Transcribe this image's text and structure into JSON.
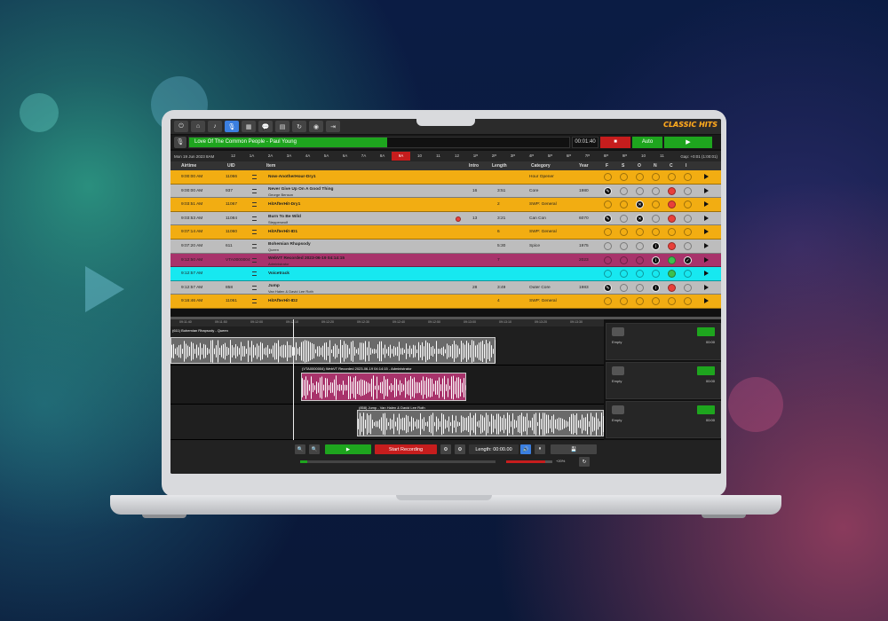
{
  "toolbar": {
    "icons": [
      "power-icon",
      "home-icon",
      "music-icon",
      "mic-icon",
      "grid-icon",
      "chat-icon",
      "document-icon",
      "refresh-icon",
      "spotify-icon",
      "exit-icon"
    ],
    "logo_text": "CLASSIC HITS",
    "active_index": 3
  },
  "now_playing": {
    "title": "Love Of The Common People - Paul Young",
    "progress": 0.52,
    "remaining": "00:01:40",
    "stop_label": "■",
    "auto_label": "Auto",
    "play_label": "▶"
  },
  "hours_bar": {
    "date": "Mon 19 Jun 2023 8AM",
    "hours": [
      "12",
      "1A",
      "2A",
      "3A",
      "4A",
      "5A",
      "6A",
      "7A",
      "8A",
      "9A",
      "10",
      "11",
      "12",
      "1P",
      "2P",
      "3P",
      "4P",
      "5P",
      "6P",
      "7P",
      "8P",
      "9P",
      "10",
      "11"
    ],
    "selected": "9A",
    "gap": "Gap: +0:01 (1:00:01)"
  },
  "columns": {
    "airtime": "Airtime",
    "uid": "UID",
    "item": "Item",
    "intro": "Intro",
    "length": "Length",
    "category": "Category",
    "year": "Year",
    "f": "F",
    "s": "S",
    "o": "O",
    "n": "N",
    "c": "C",
    "i": "I"
  },
  "rows": [
    {
      "airtime": "9:00:00 AM",
      "uid": "11066",
      "title": "Now-AnotherHour-Dry1",
      "artist": "",
      "intro": "",
      "length": "",
      "category": "Hour Opener",
      "year": "",
      "color": "#f2ad12",
      "marks": []
    },
    {
      "airtime": "9:00:00 AM",
      "uid": "937",
      "title": "Never Give Up On A Good Thing",
      "artist": "George Benson",
      "intro": "16",
      "length": "3:51",
      "category": "Core",
      "year": "1980",
      "color": "#bdbdbd",
      "marks": [
        "f",
        "red"
      ]
    },
    {
      "airtime": "9:03:51 AM",
      "uid": "11067",
      "title": "HitAfterHit-Dry1",
      "artist": "",
      "intro": "",
      "length": "2",
      "category": "SWP: General",
      "year": "",
      "color": "#f2ad12",
      "marks": [
        "o",
        "red"
      ]
    },
    {
      "airtime": "9:03:53 AM",
      "uid": "11084",
      "title": "Burn To Be Wild",
      "artist": "Steppenwolf",
      "intro": "13",
      "length": "3:21",
      "category": "Can Con",
      "year": "6070",
      "color": "#bdbdbd",
      "marks": [
        "f",
        "o",
        "red",
        "dot"
      ]
    },
    {
      "airtime": "9:07:14 AM",
      "uid": "11060",
      "title": "HitAfterHit-ID1",
      "artist": "",
      "intro": "",
      "length": "6",
      "category": "SWP: General",
      "year": "",
      "color": "#f2ad12",
      "marks": []
    },
    {
      "airtime": "9:07:20 AM",
      "uid": "611",
      "title": "Bohemian Rhapsody",
      "artist": "Queen",
      "intro": "",
      "length": "5:30",
      "category": "Spice",
      "year": "1975",
      "color": "#bdbdbd",
      "marks": [
        "n",
        "red"
      ]
    },
    {
      "airtime": "9:12:50 AM",
      "uid": "VTA0000004",
      "title": "WebVT Recorded 2023-06-19 04:14:15",
      "artist": "Administrator",
      "intro": "",
      "length": "7",
      "category": "",
      "year": "2023",
      "color": "#a8336b",
      "marks": [
        "n",
        "green",
        "check"
      ]
    },
    {
      "airtime": "9:12:57 AM",
      "uid": "",
      "title": "Voicetrack",
      "artist": "",
      "intro": "",
      "length": "",
      "category": "",
      "year": "",
      "color": "#17e8f0",
      "marks": [
        "green"
      ]
    },
    {
      "airtime": "9:12:57 AM",
      "uid": "858",
      "title": "Jump",
      "artist": "Van Halen & David Lee Roth",
      "intro": "28",
      "length": "3:49",
      "category": "Outer Core",
      "year": "1983",
      "color": "#bdbdbd",
      "marks": [
        "f",
        "n",
        "red"
      ]
    },
    {
      "airtime": "9:16:46 AM",
      "uid": "11061",
      "title": "HitAfterHit-ID2",
      "artist": "",
      "intro": "",
      "length": "4",
      "category": "SWP: General",
      "year": "",
      "color": "#f2ad12",
      "marks": []
    }
  ],
  "ruler_ticks": [
    "09:11:40",
    "09:11:50",
    "09:12:00",
    "09:12:10",
    "09:12:20",
    "09:12:30",
    "09:12:40",
    "09:12:50",
    "09:13:00",
    "09:13:10",
    "09:13:20",
    "09:13:30"
  ],
  "clips": [
    {
      "label": "(611) Bohemian Rhapsody - Queen"
    },
    {
      "label": "(VTA0000004) WebVT Recorded 2023-06-19 04:14:15 - Administrator"
    },
    {
      "label": "(858) Jump - Van Halen & David Lee Roth"
    }
  ],
  "slots": [
    {
      "label": "Empty",
      "time": "00:00"
    },
    {
      "label": "Empty",
      "time": "00:00"
    },
    {
      "label": "Empty",
      "time": "00:00"
    }
  ],
  "transport": {
    "zoom_out_icon": "zoom-out-icon",
    "zoom_in_icon": "zoom-in-icon",
    "play_label": "▶",
    "record_label": "Start Recording",
    "length_label": "Length: 00:00.00",
    "volume_label": "+20%"
  }
}
